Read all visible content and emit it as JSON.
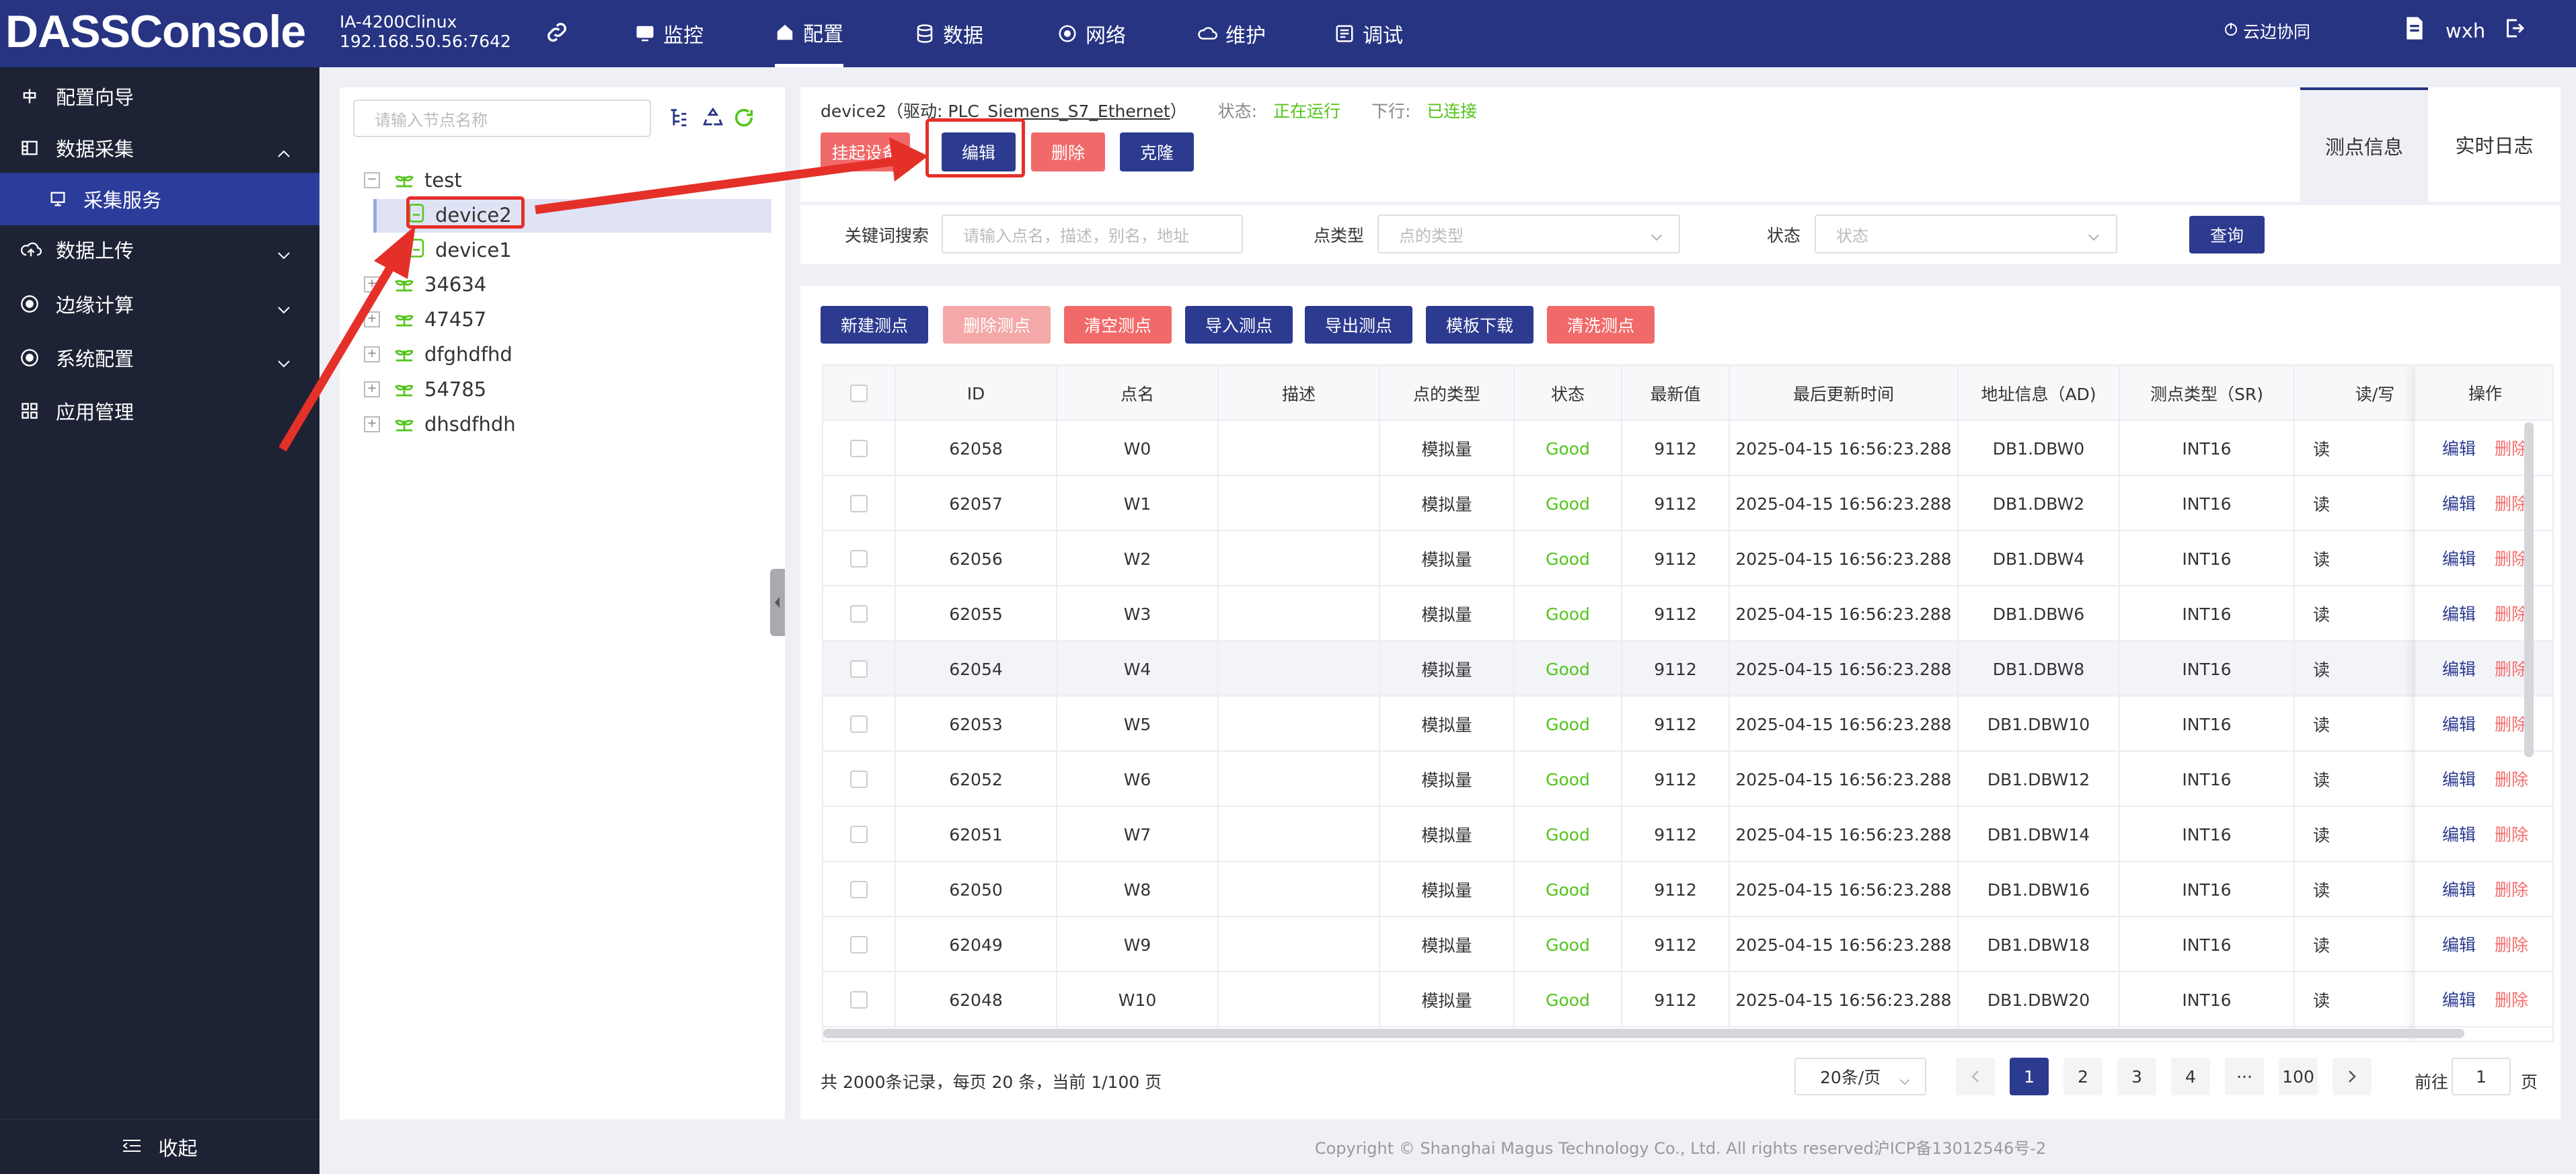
{
  "app": {
    "logo": "DASSConsole",
    "device_model": "IA-4200Clinux",
    "device_ip": "192.168.50.56:7642"
  },
  "topnav": [
    {
      "label": "监控",
      "icon": "monitor-icon"
    },
    {
      "label": "配置",
      "icon": "config-icon",
      "active": true
    },
    {
      "label": "数据",
      "icon": "database-icon"
    },
    {
      "label": "网络",
      "icon": "network-icon"
    },
    {
      "label": "维护",
      "icon": "cloud-maintenance-icon"
    },
    {
      "label": "调试",
      "icon": "debug-icon"
    }
  ],
  "cloud_link": "云边协同",
  "user": {
    "name": "wxh"
  },
  "sidebar": {
    "items": [
      {
        "label": "配置向导",
        "icon": "wizard-icon"
      },
      {
        "label": "数据采集",
        "icon": "data-collect-icon",
        "expanded": true
      },
      {
        "label": "采集服务",
        "icon": "service-icon",
        "selected": true
      },
      {
        "label": "数据上传",
        "icon": "upload-icon"
      },
      {
        "label": "边缘计算",
        "icon": "edge-compute-icon"
      },
      {
        "label": "系统配置",
        "icon": "system-config-icon"
      },
      {
        "label": "应用管理",
        "icon": "app-grid-icon"
      }
    ],
    "collapse_label": "收起"
  },
  "tree": {
    "search_placeholder": "请输入节点名称",
    "nodes": [
      {
        "label": "test",
        "expanded": true
      },
      {
        "label": "device2",
        "child": true,
        "selected": true
      },
      {
        "label": "device1",
        "child": true
      },
      {
        "label": "34634"
      },
      {
        "label": "47457"
      },
      {
        "label": "dfghdfhd"
      },
      {
        "label": "54785"
      },
      {
        "label": "dhsdfhdh"
      }
    ]
  },
  "device": {
    "name": "device2",
    "driver_prefix": "（驱动:",
    "driver": "PLC_Siemens_S7_Ethernet",
    "driver_suffix": "）",
    "status_label": "状态:",
    "status_value": "正在运行",
    "downlink_label": "下行:",
    "downlink_value": "已连接",
    "buttons": {
      "suspend": "挂起设备",
      "edit": "编辑",
      "delete": "删除",
      "clone": "克隆"
    }
  },
  "right_tabs": {
    "points": "测点信息",
    "log": "实时日志"
  },
  "filter": {
    "keyword_label": "关键词搜索",
    "keyword_placeholder": "请输入点名，描述，别名，地址",
    "type_label": "点类型",
    "type_placeholder": "点的类型",
    "status_label": "状态",
    "status_placeholder": "状态",
    "query": "查询"
  },
  "toolbar": {
    "new_point": "新建测点",
    "delete_point": "删除测点",
    "clear_points": "清空测点",
    "import_points": "导入测点",
    "export_points": "导出测点",
    "template_download": "模板下载",
    "wash_points": "清洗测点"
  },
  "table": {
    "headers": [
      "ID",
      "点名",
      "描述",
      "点的类型",
      "状态",
      "最新值",
      "最后更新时间",
      "地址信息（AD)",
      "测点类型（SR)",
      "读/写",
      "操作"
    ],
    "rows": [
      [
        "62058",
        "W0",
        "",
        "模拟量",
        "Good",
        "9112",
        "2025-04-15 16:56:23.288",
        "DB1.DBW0",
        "INT16",
        "读"
      ],
      [
        "62057",
        "W1",
        "",
        "模拟量",
        "Good",
        "9112",
        "2025-04-15 16:56:23.288",
        "DB1.DBW2",
        "INT16",
        "读"
      ],
      [
        "62056",
        "W2",
        "",
        "模拟量",
        "Good",
        "9112",
        "2025-04-15 16:56:23.288",
        "DB1.DBW4",
        "INT16",
        "读"
      ],
      [
        "62055",
        "W3",
        "",
        "模拟量",
        "Good",
        "9112",
        "2025-04-15 16:56:23.288",
        "DB1.DBW6",
        "INT16",
        "读"
      ],
      [
        "62054",
        "W4",
        "",
        "模拟量",
        "Good",
        "9112",
        "2025-04-15 16:56:23.288",
        "DB1.DBW8",
        "INT16",
        "读"
      ],
      [
        "62053",
        "W5",
        "",
        "模拟量",
        "Good",
        "9112",
        "2025-04-15 16:56:23.288",
        "DB1.DBW10",
        "INT16",
        "读"
      ],
      [
        "62052",
        "W6",
        "",
        "模拟量",
        "Good",
        "9112",
        "2025-04-15 16:56:23.288",
        "DB1.DBW12",
        "INT16",
        "读"
      ],
      [
        "62051",
        "W7",
        "",
        "模拟量",
        "Good",
        "9112",
        "2025-04-15 16:56:23.288",
        "DB1.DBW14",
        "INT16",
        "读"
      ],
      [
        "62050",
        "W8",
        "",
        "模拟量",
        "Good",
        "9112",
        "2025-04-15 16:56:23.288",
        "DB1.DBW16",
        "INT16",
        "读"
      ],
      [
        "62049",
        "W9",
        "",
        "模拟量",
        "Good",
        "9112",
        "2025-04-15 16:56:23.288",
        "DB1.DBW18",
        "INT16",
        "读"
      ],
      [
        "62048",
        "W10",
        "",
        "模拟量",
        "Good",
        "9112",
        "2025-04-15 16:56:23.288",
        "DB1.DBW20",
        "INT16",
        "读"
      ]
    ],
    "op_edit": "编辑",
    "op_delete": "删除"
  },
  "pagination": {
    "summary": "共 2000条记录，每页 20 条，当前 1/100 页",
    "page_size": "20条/页",
    "pages": [
      "1",
      "2",
      "3",
      "4",
      "···",
      "100"
    ],
    "current": "1",
    "goto_label": "前往",
    "goto_value": "1",
    "goto_suffix": "页"
  },
  "footer": "Copyright © Shanghai Magus Technology Co., Ltd. All rights reserved沪ICP备13012546号-2",
  "colors": {
    "brand": "#273482",
    "sidebar": "#1d2334",
    "good": "#52c41a",
    "danger": "#f16a6a",
    "annotation": "#e5302a"
  }
}
